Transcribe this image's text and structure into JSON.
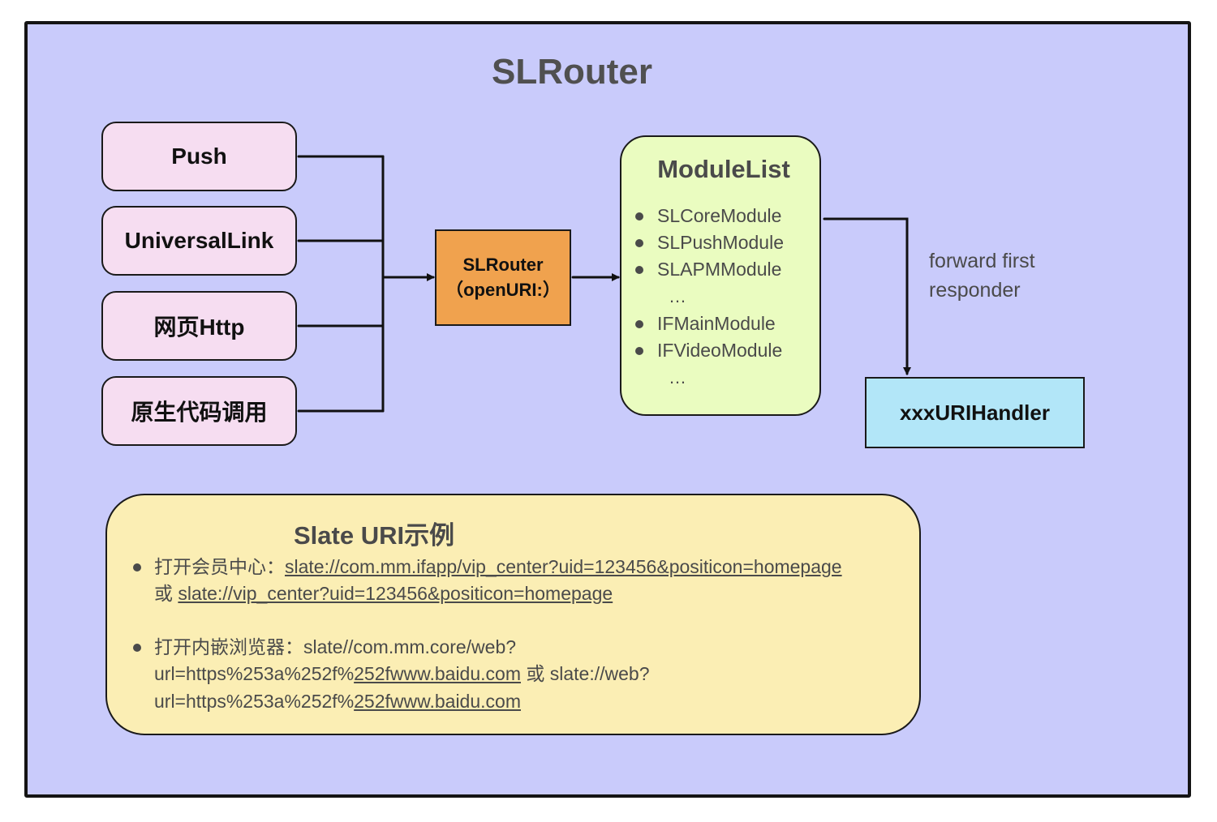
{
  "diagram": {
    "title": "SLRouter",
    "sources": [
      "Push",
      "UniversalLink",
      "网页Http",
      "原生代码调用"
    ],
    "router": {
      "line1": "SLRouter",
      "line2": "（openURI:）"
    },
    "module_list": {
      "title": "ModuleList",
      "items": [
        "SLCoreModule",
        "SLPushModule",
        "SLAPMModule",
        "IFMainModule",
        "IFVideoModule"
      ],
      "ellipsis": "…"
    },
    "forward_label": "forward first responder",
    "handler": "xxxURIHandler",
    "example": {
      "title": "Slate URI示例",
      "item1": {
        "prefix": "打开会员中心：",
        "link1": "slate://com.mm.ifapp/vip_center?uid=123456&positicon=homepage",
        "or": "或 ",
        "link2": "slate://vip_center?uid=123456&positicon=homepage"
      },
      "item2": {
        "line1": "打开内嵌浏览器：slate//com.mm.core/web?",
        "line2_plain": "url=https%253a%252f%",
        "line2_link": "252fwww.baidu.com",
        "line2_tail": " 或 slate://web?",
        "line3_plain": "url=https%253a%252f%",
        "line3_link": "252fwww.baidu.com"
      }
    },
    "colors": {
      "background": "#c9cbfb",
      "source_box": "#f6ddf1",
      "router_box": "#f0a24e",
      "module_box": "#eafcc0",
      "handler_box": "#b2e6f8",
      "example_box": "#fbeeb4"
    }
  }
}
